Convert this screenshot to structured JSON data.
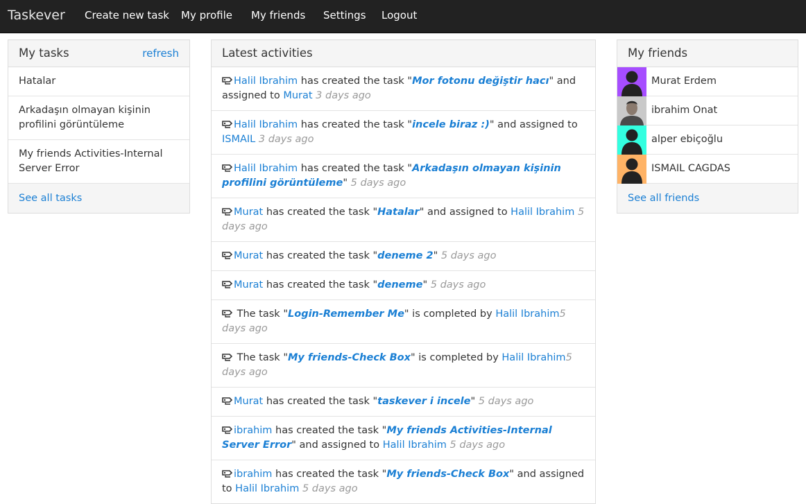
{
  "navbar": {
    "brand": "Taskever",
    "items": [
      "Create new task",
      "My profile",
      "My friends",
      "Settings",
      "Logout"
    ]
  },
  "my_tasks": {
    "title": "My tasks",
    "refresh_label": "refresh",
    "items": [
      "Hatalar",
      "Arkadaşın olmayan kişinin profilini görüntüleme",
      "My friends Activities-Internal Server Error"
    ],
    "see_all_label": "See all tasks"
  },
  "activities": {
    "title": "Latest activities",
    "items": [
      {
        "user": "Halil Ibrahim",
        "verb": " has created the task \"",
        "task": "Mor fotonu değiştir hacı",
        "mid": "\" and assigned to ",
        "assignee": "Murat",
        "time": "3 days ago"
      },
      {
        "user": "Halil Ibrahim",
        "verb": " has created the task \"",
        "task": "incele biraz :)",
        "mid": "\" and assigned to ",
        "assignee": "ISMAIL",
        "time": "3 days ago"
      },
      {
        "user": "Halil Ibrahim",
        "verb": " has created the task \"",
        "task": "Arkadaşın olmayan kişinin profilini görüntüleme",
        "mid": "\"",
        "assignee": "",
        "time": "5 days ago"
      },
      {
        "user": "Murat",
        "verb": " has created the task \"",
        "task": "Hatalar",
        "mid": "\" and assigned to ",
        "assignee": "Halil Ibrahim",
        "time": "5 days ago"
      },
      {
        "user": "Murat",
        "verb": " has created the task \"",
        "task": "deneme 2",
        "mid": "\"",
        "assignee": "",
        "time": "5 days ago"
      },
      {
        "user": "Murat",
        "verb": " has created the task \"",
        "task": "deneme",
        "mid": "\"",
        "assignee": "",
        "time": "5 days ago"
      },
      {
        "user": "",
        "verb": " The task \"",
        "task": "Login-Remember Me",
        "mid": "\" is completed by ",
        "assignee": "Halil Ibrahim",
        "time": "5 days ago"
      },
      {
        "user": "",
        "verb": " The task \"",
        "task": "My friends-Check Box",
        "mid": "\" is completed by ",
        "assignee": "Halil Ibrahim",
        "time": "5 days ago"
      },
      {
        "user": "Murat",
        "verb": " has created the task \"",
        "task": "taskever i incele",
        "mid": "\"",
        "assignee": "",
        "time": "5 days ago"
      },
      {
        "user": "ibrahim",
        "verb": " has created the task \"",
        "task": "My friends Activities-Internal Server Error",
        "mid": "\" and assigned to ",
        "assignee": "Halil Ibrahim",
        "time": "5 days ago"
      },
      {
        "user": "ibrahim",
        "verb": " has created the task \"",
        "task": "My friends-Check Box",
        "mid": "\" and assigned to ",
        "assignee": "Halil Ibrahim",
        "time": "5 days ago"
      }
    ]
  },
  "my_friends": {
    "title": "My friends",
    "items": [
      {
        "name": "Murat Erdem",
        "avatar_bg": "#a64dff",
        "avatar": "silhouette"
      },
      {
        "name": "ibrahim Onat",
        "avatar_bg": "#bbbbbb",
        "avatar": "photo"
      },
      {
        "name": "alper ebiçoğlu",
        "avatar_bg": "#33ffe0",
        "avatar": "silhouette"
      },
      {
        "name": "ISMAIL CAGDAS",
        "avatar_bg": "#ffb366",
        "avatar": "silhouette"
      }
    ],
    "see_all_label": "See all friends"
  },
  "colors": {
    "navbar_bg": "#222222",
    "link": "#1a7fd4",
    "muted": "#999999",
    "panel_heading_bg": "#f5f5f5"
  }
}
